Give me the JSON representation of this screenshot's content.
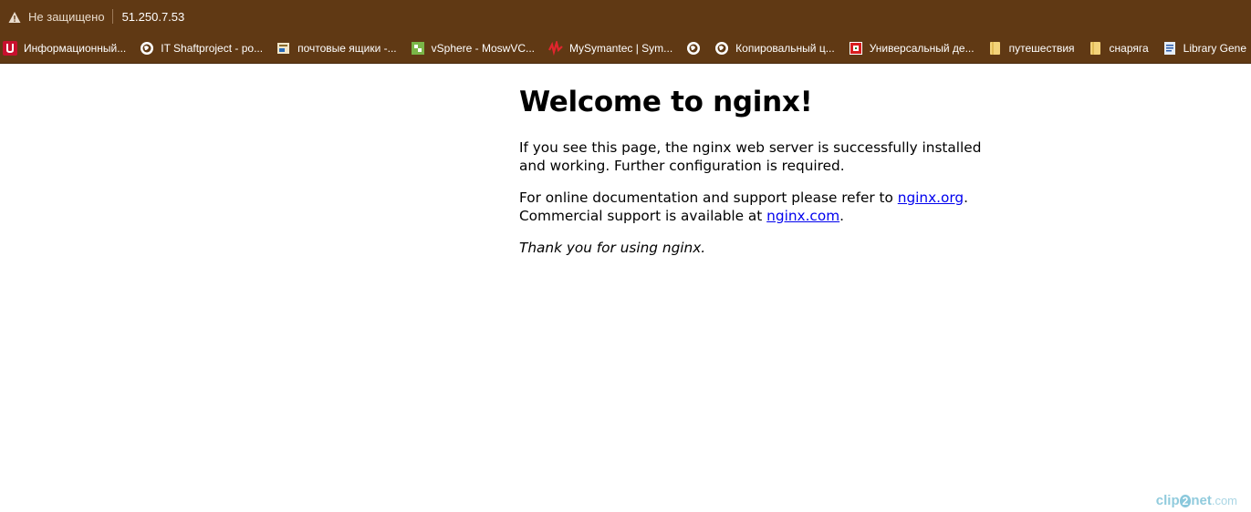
{
  "address_bar": {
    "security_text": "Не защищено",
    "url": "51.250.7.53"
  },
  "bookmarks": [
    {
      "label": "Информационный...",
      "icon": "u-logo-icon"
    },
    {
      "label": "IT Shaftproject - po...",
      "icon": "globe-icon"
    },
    {
      "label": "почтовые ящики -...",
      "icon": "mail-page-icon"
    },
    {
      "label": "vSphere - MoswVC...",
      "icon": "vsphere-icon"
    },
    {
      "label": "MySymantec | Sym...",
      "icon": "symantec-icon"
    },
    {
      "label": "",
      "icon": "globe-icon"
    },
    {
      "label": "Копировальный ц...",
      "icon": "globe-icon"
    },
    {
      "label": "Универсальный де...",
      "icon": "red-logo-icon"
    },
    {
      "label": "путешествия",
      "icon": "folder-icon"
    },
    {
      "label": "снаряга",
      "icon": "folder-icon"
    },
    {
      "label": "Library Gene",
      "icon": "library-icon"
    }
  ],
  "page": {
    "title": "Welcome to nginx!",
    "para1": "If you see this page, the nginx web server is successfully installed and working. Further configuration is required.",
    "para2_prefix": "For online documentation and support please refer to ",
    "link1": "nginx.org",
    "para2_mid": ".",
    "para2_line2": "Commercial support is available at ",
    "link2": "nginx.com",
    "para2_end": ".",
    "thanks": "Thank you for using nginx."
  },
  "watermark": {
    "part1": "clip",
    "part2": "2",
    "part3": "net",
    "part4": ".com"
  },
  "colors": {
    "frame": "#603914",
    "link": "#0000ee"
  }
}
